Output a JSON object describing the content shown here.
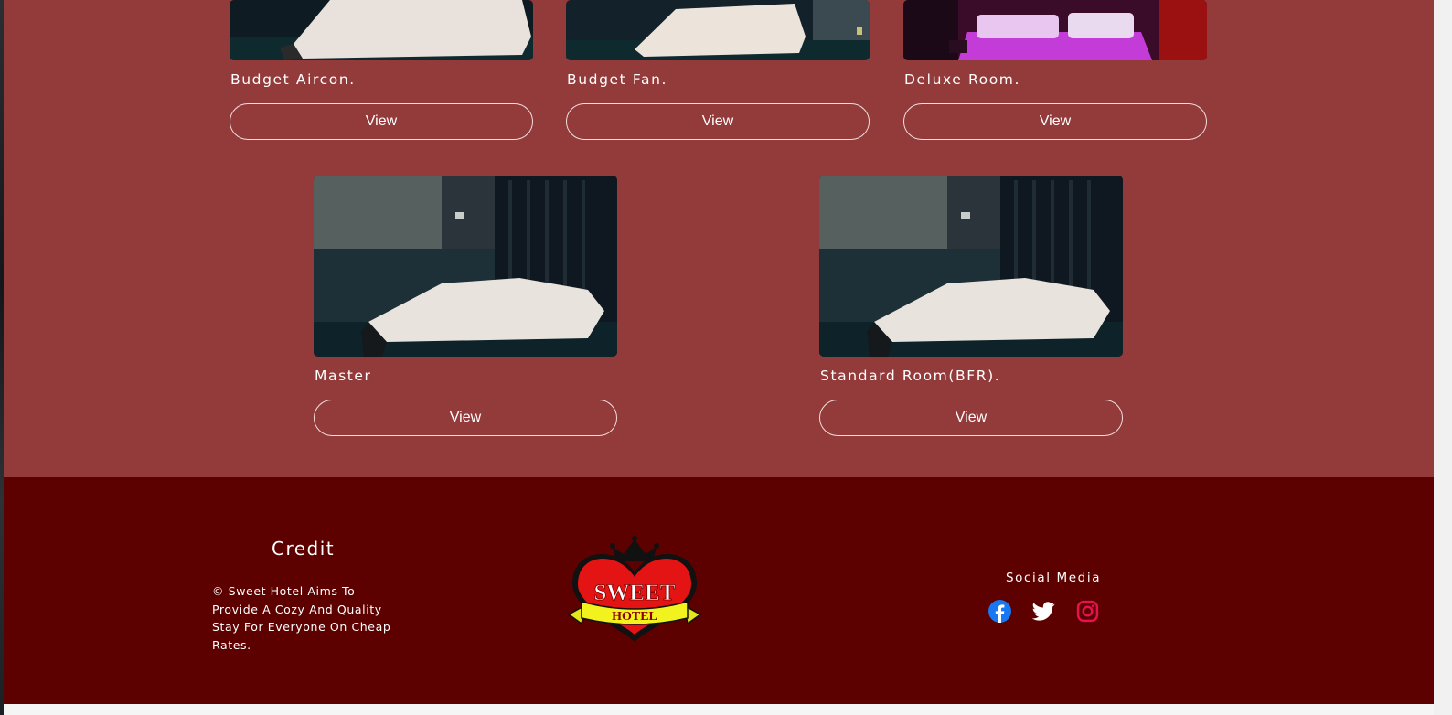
{
  "rooms": [
    {
      "name": "Budget Aircon.",
      "button": "View",
      "photo": "dark-room-bed-photo"
    },
    {
      "name": "Budget Fan.",
      "button": "View",
      "photo": "dark-room-bed-photo"
    },
    {
      "name": "Deluxe Room.",
      "button": "View",
      "photo": "purple-lit-room-photo"
    },
    {
      "name": "Master",
      "button": "View",
      "photo": "dark-room-bed-photo"
    },
    {
      "name": "Standard Room(BFR).",
      "button": "View",
      "photo": "dark-room-bed-photo"
    }
  ],
  "footer": {
    "credit_title": "Credit",
    "credit_text": "© Sweet Hotel Aims To Provide A Cozy And Quality Stay For Everyone On Cheap Rates.",
    "logo_text_line1": "SWEET",
    "logo_text_line2": "HOTEL",
    "social_title": "Social Media",
    "social_icons": [
      "facebook-icon",
      "twitter-icon",
      "instagram-icon"
    ]
  },
  "colors": {
    "rooms_bg": "#933a3a",
    "footer_bg": "#5c0000",
    "facebook": "#1877f2",
    "twitter": "#ffffff",
    "instagram": "#e4134f"
  }
}
